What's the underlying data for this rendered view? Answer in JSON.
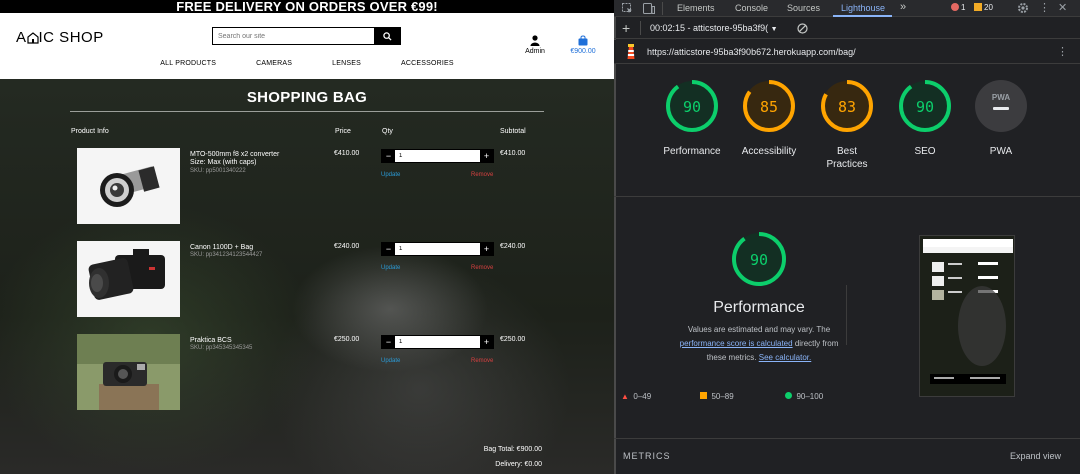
{
  "shop": {
    "banner": "FREE DELIVERY ON ORDERS OVER €99!",
    "logo_text": "ATTIC SHOP",
    "logo_left": "A",
    "logo_right": "IC SHOP",
    "search_placeholder": "Search our site",
    "account_label": "Admin",
    "cart_total": "€900.00",
    "nav": [
      "ALL PRODUCTS",
      "CAMERAS",
      "LENSES",
      "ACCESSORIES"
    ],
    "bag_title": "SHOPPING BAG",
    "columns": {
      "info": "Product Info",
      "price": "Price",
      "qty": "Qty",
      "subtotal": "Subtotal"
    },
    "items": [
      {
        "name": "MTO-500mm f8 x2 converter",
        "size": "Size: Max (with caps)",
        "sku": "SKU: pp5001340222",
        "price": "€410.00",
        "qty": "1",
        "subtotal": "€410.00",
        "update": "Update",
        "remove": "Remove"
      },
      {
        "name": "Canon 1100D + Bag",
        "size": "",
        "sku": "SKU: pp341234123544427",
        "price": "€240.00",
        "qty": "1",
        "subtotal": "€240.00",
        "update": "Update",
        "remove": "Remove"
      },
      {
        "name": "Praktica BCS",
        "size": "",
        "sku": "SKU: pp345345345345",
        "price": "€250.00",
        "qty": "1",
        "subtotal": "€250.00",
        "update": "Update",
        "remove": "Remove"
      }
    ],
    "bag_total": "Bag Total: €900.00",
    "delivery": "Delivery: €0.00"
  },
  "devtools": {
    "tabs": [
      "Elements",
      "Console",
      "Sources",
      "Lighthouse"
    ],
    "active_tab": "Lighthouse",
    "error_count": "1",
    "warning_count": "20",
    "report_select": "00:02:15 - atticstore-95ba3f9(",
    "report_url": "https://atticstore-95ba3f90b672.herokuapp.com/bag/",
    "gauges": [
      {
        "score": "90",
        "label": "Performance",
        "color": "#0cce6b",
        "fraction": 0.9
      },
      {
        "score": "85",
        "label": "Accessibility",
        "color": "#ffa400",
        "fraction": 0.85
      },
      {
        "score": "83",
        "label": "Best Practices",
        "color": "#ffa400",
        "fraction": 0.83
      },
      {
        "score": "90",
        "label": "SEO",
        "color": "#0cce6b",
        "fraction": 0.9
      },
      {
        "score": "PWA",
        "label": "PWA",
        "color": "#9aa0a6",
        "fraction": 0
      }
    ],
    "perf": {
      "score": "90",
      "title": "Performance",
      "desc_1": "Values are estimated and may vary. The",
      "desc_link_1": "performance score is calculated",
      "desc_2": "directly from",
      "desc_3": "these metrics.",
      "desc_link_2": "See calculator.",
      "legend_bad": "0–49",
      "legend_avg": "50–89",
      "legend_good": "90–100"
    },
    "metrics_label": "METRICS",
    "expand_label": "Expand view"
  }
}
